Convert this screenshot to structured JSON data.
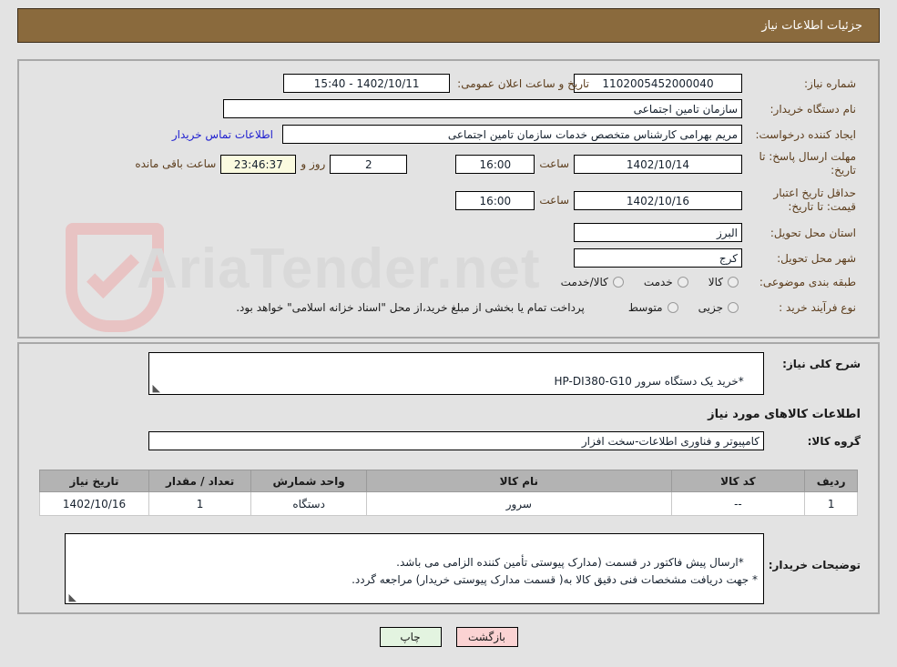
{
  "header": {
    "title": "جزئیات اطلاعات نیاز",
    "bg_color": "#8a6a3d",
    "text_color": "#ffffff"
  },
  "main_panel": {
    "need_number": {
      "label": "شماره نیاز:",
      "value": "1102005452000040"
    },
    "announce_datetime": {
      "label": "تاریخ و ساعت اعلان عمومی:",
      "value": "1402/10/11 - 15:40"
    },
    "buyer_org": {
      "label": "نام دستگاه خریدار:",
      "value": "سازمان تامین اجتماعی"
    },
    "request_creator": {
      "label": "ایجاد کننده درخواست:",
      "value": "مریم بهرامی کارشناس متخصص خدمات  سازمان تامین اجتماعی",
      "contact_link": "اطلاعات تماس خریدار"
    },
    "response_deadline": {
      "label": "مهلت ارسال پاسخ: تا تاریخ:",
      "date": "1402/10/14",
      "time_label": "ساعت",
      "time": "16:00",
      "days": "2",
      "days_label": "روز و",
      "countdown": "23:46:37",
      "countdown_suffix": "ساعت باقی مانده"
    },
    "price_validity": {
      "label": "حداقل تاریخ اعتبار قیمت: تا تاریخ:",
      "date": "1402/10/16",
      "time_label": "ساعت",
      "time": "16:00"
    },
    "delivery_province": {
      "label": "استان محل تحویل:",
      "value": "البرز"
    },
    "delivery_city": {
      "label": "شهر محل تحویل:",
      "value": "کرج"
    },
    "subject_category": {
      "label": "طبقه بندی موضوعی:",
      "options": [
        "کالا",
        "خدمت",
        "کالا/خدمت"
      ],
      "selected": ""
    },
    "purchase_process": {
      "label": "نوع فرآیند خرید :",
      "options": [
        "جزیی",
        "متوسط"
      ],
      "selected": "",
      "note": "پرداخت تمام یا بخشی از مبلغ خرید،از محل \"اسناد خزانه اسلامی\" خواهد بود."
    }
  },
  "lower_panel": {
    "need_summary": {
      "label": "شرح کلی نیاز:",
      "value": "*خرید یک دستگاه سرور HP-DI380-G10"
    },
    "goods_section_title": "اطلاعات کالاهای مورد نیاز",
    "goods_group": {
      "label": "گروه کالا:",
      "value": "کامپیوتر و فناوری اطلاعات-سخت افزار"
    },
    "items_table": {
      "columns": [
        "ردیف",
        "کد کالا",
        "نام کالا",
        "واحد شمارش",
        "تعداد / مقدار",
        "تاریخ نیاز"
      ],
      "rows": [
        [
          "1",
          "--",
          "سرور",
          "دستگاه",
          "1",
          "1402/10/16"
        ]
      ]
    },
    "buyer_notes": {
      "label": "توضیحات خریدار:",
      "value": "*ارسال پیش فاکتور در قسمت (مدارک پیوستی تأمین کننده الزامی می باشد.\n* جهت دریافت مشخصات فنی دقیق کالا به( قسمت مدارک پیوستی خریدار) مراجعه گردد."
    }
  },
  "footer": {
    "print_button": "چاپ",
    "back_button": "بازگشت"
  },
  "watermark": {
    "text": "AriaTender.net",
    "icon": "shield-check-icon"
  }
}
